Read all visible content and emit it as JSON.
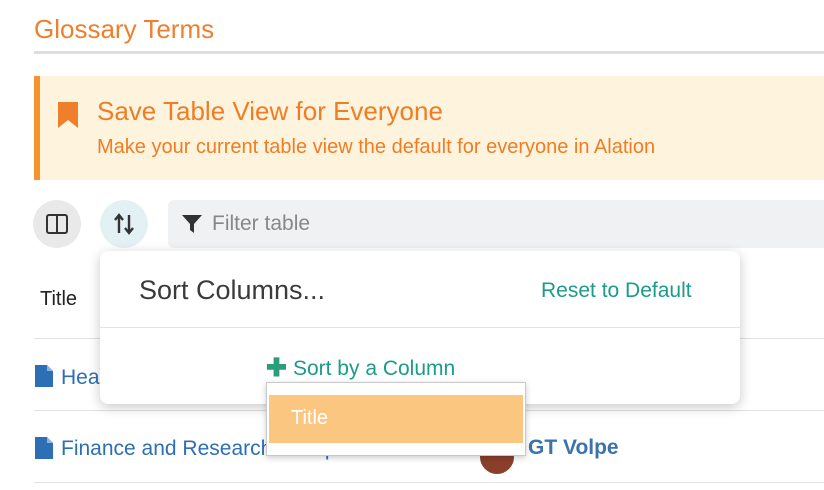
{
  "page": {
    "title": "Glossary Terms"
  },
  "banner": {
    "title": "Save Table View for Everyone",
    "subtitle": "Make your current table view the default for everyone in Alation",
    "icon": "bookmark-icon"
  },
  "toolbar": {
    "columns_icon": "columns-icon",
    "sort_icon": "sort-arrows-icon",
    "filter": {
      "icon": "filter-icon",
      "placeholder": "Filter table",
      "value": ""
    }
  },
  "table": {
    "columns": [
      "Title"
    ],
    "rows": [
      {
        "title": "Hea",
        "icon": "document-icon"
      },
      {
        "title": "Finance and Research Group",
        "icon": "document-icon",
        "owner": "GT Volpe"
      }
    ]
  },
  "sort_popover": {
    "title": "Sort Columns...",
    "reset_label": "Reset to Default",
    "add_label": "Sort by a Column",
    "add_icon": "plus-icon"
  },
  "sort_dropdown": {
    "options": [
      "Title"
    ]
  },
  "colors": {
    "accent_orange": "#f07f2d",
    "teal": "#1d9b8a",
    "link_blue": "#2d6fb4",
    "highlight": "#fbc780"
  }
}
